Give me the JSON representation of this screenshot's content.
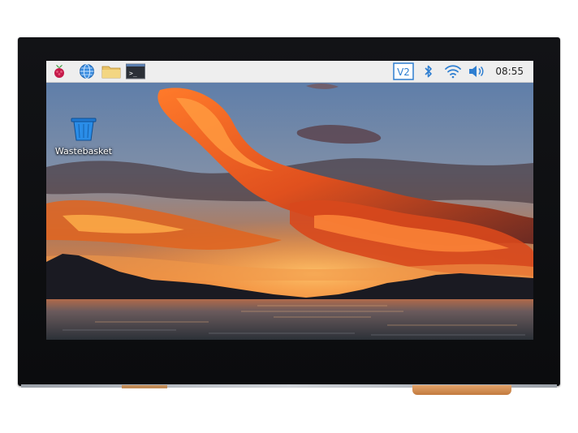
{
  "taskbar": {
    "menu_icon": "raspberry-icon",
    "launchers": [
      {
        "icon": "globe-icon"
      },
      {
        "icon": "folder-icon"
      },
      {
        "icon": "terminal-icon",
        "glyph": ">_"
      }
    ],
    "tray": {
      "vnc_label": "V2",
      "clock": "08:55",
      "icons": [
        "vnc-icon",
        "bluetooth-icon",
        "wifi-icon",
        "volume-icon"
      ]
    }
  },
  "desktop": {
    "items": [
      {
        "label": "Wastebasket",
        "icon": "wastebasket-icon"
      }
    ]
  },
  "colors": {
    "taskbar_bg": "#eeeeee",
    "accent_blue": "#2f7fd1",
    "bezel": "#101114"
  }
}
